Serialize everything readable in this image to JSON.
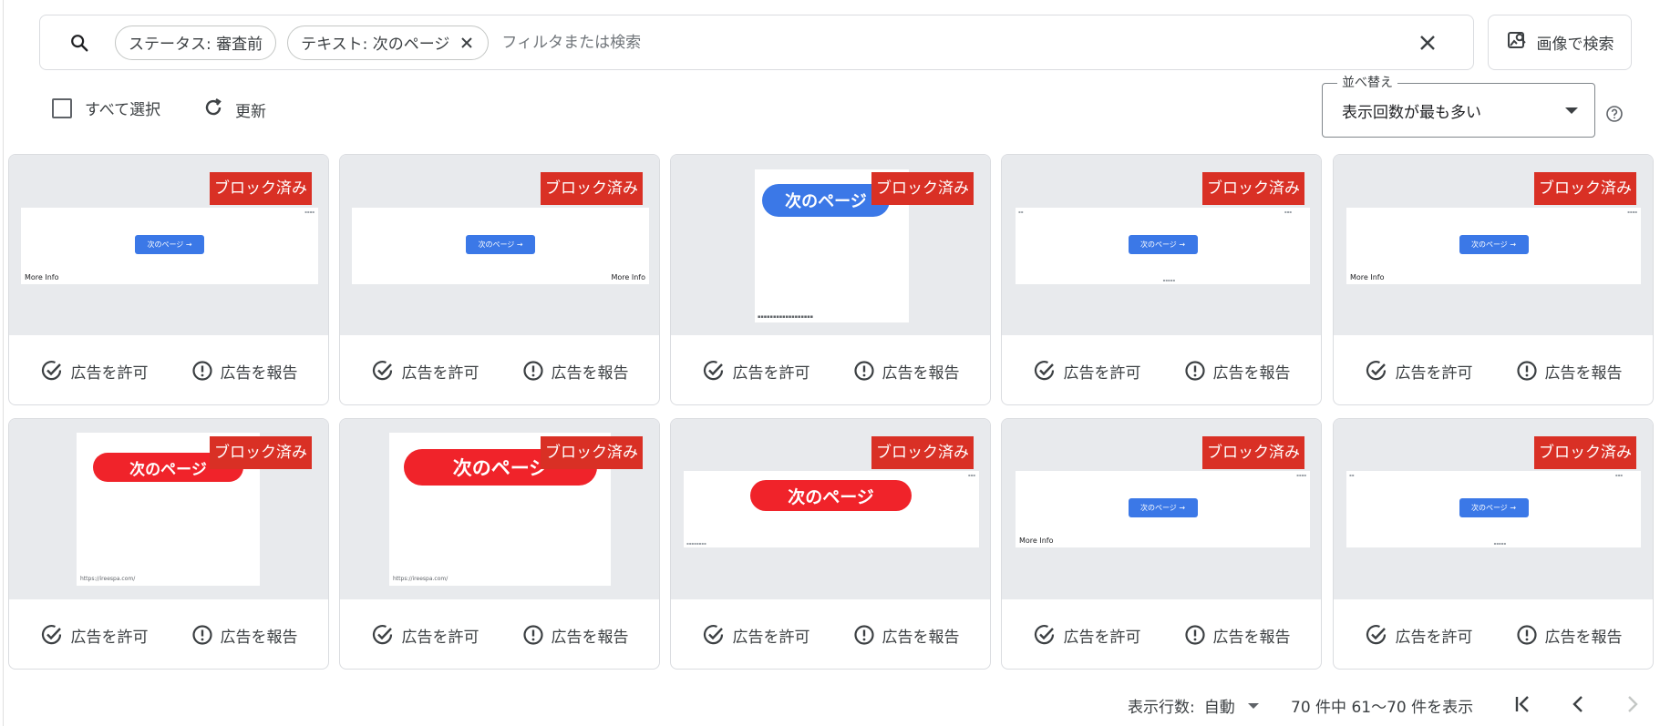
{
  "search": {
    "chips": [
      {
        "label": "ステータス: 審査前",
        "removable": false
      },
      {
        "label": "テキスト: 次のページ",
        "removable": true
      }
    ],
    "placeholder": "フィルタまたは検索",
    "image_search_label": "画像で検索"
  },
  "toolbar": {
    "select_all_label": "すべて選択",
    "refresh_label": "更新",
    "sort_legend": "並べ替え",
    "sort_value": "表示回数が最も多い"
  },
  "card_labels": {
    "badge": "ブロック済み",
    "allow": "広告を許可",
    "report": "広告を報告"
  },
  "ads": {
    "button_text": "次のページ →",
    "pill_text": "次のページ",
    "more_info": "More Info",
    "url_ireespa": "https://ireespa.com/"
  },
  "footer": {
    "rows_label": "表示行数:",
    "rows_value": "自動",
    "range": "70 件中 61～70 件を表示"
  },
  "colors": {
    "badge": "#d93025",
    "ad_blue_button": "#3b78e7",
    "ad_red_pill": "#f0232a",
    "thumb_bg": "#e8eaed"
  }
}
